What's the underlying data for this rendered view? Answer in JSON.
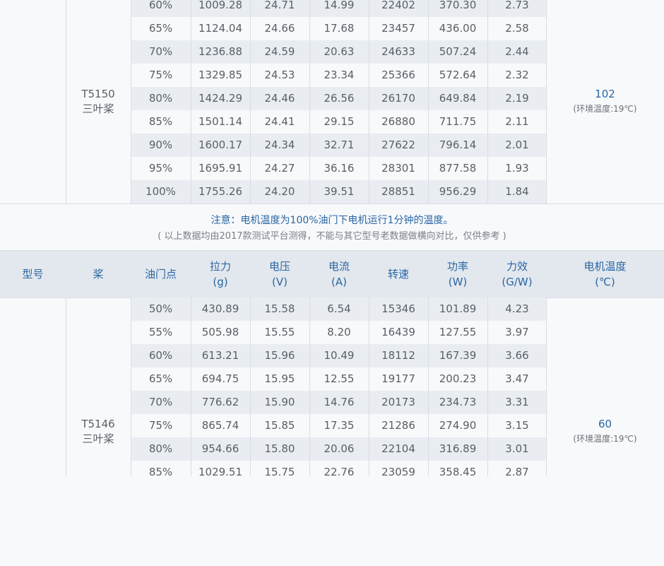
{
  "top_section": {
    "model": "T5150",
    "prop": "三叶桨",
    "temp": "102",
    "temp_note": "(环境温度:19℃)",
    "rows": [
      [
        "60%",
        "1009.28",
        "24.71",
        "14.99",
        "22402",
        "370.30",
        "2.73"
      ],
      [
        "65%",
        "1124.04",
        "24.66",
        "17.68",
        "23457",
        "436.00",
        "2.58"
      ],
      [
        "70%",
        "1236.88",
        "24.59",
        "20.63",
        "24633",
        "507.24",
        "2.44"
      ],
      [
        "75%",
        "1329.85",
        "24.53",
        "23.34",
        "25366",
        "572.64",
        "2.32"
      ],
      [
        "80%",
        "1424.29",
        "24.46",
        "26.56",
        "26170",
        "649.84",
        "2.19"
      ],
      [
        "85%",
        "1501.14",
        "24.41",
        "29.15",
        "26880",
        "711.75",
        "2.11"
      ],
      [
        "90%",
        "1600.17",
        "24.34",
        "32.71",
        "27622",
        "796.14",
        "2.01"
      ],
      [
        "95%",
        "1695.91",
        "24.27",
        "36.16",
        "28301",
        "877.58",
        "1.93"
      ],
      [
        "100%",
        "1755.26",
        "24.20",
        "39.51",
        "28851",
        "956.29",
        "1.84"
      ]
    ]
  },
  "note": {
    "main": "注意：电机温度为100%油门下电机运行1分钟的温度。",
    "sub": "( 以上数据均由2017款测试平台测得，不能与其它型号老数据做横向对比，仅供参考 )"
  },
  "headers": [
    {
      "line1": "型号",
      "line2": ""
    },
    {
      "line1": "桨",
      "line2": ""
    },
    {
      "line1": "油门点",
      "line2": ""
    },
    {
      "line1": "拉力",
      "line2": "(g)"
    },
    {
      "line1": "电压",
      "line2": "(V)"
    },
    {
      "line1": "电流",
      "line2": "(A)"
    },
    {
      "line1": "转速",
      "line2": ""
    },
    {
      "line1": "功率",
      "line2": "(W)"
    },
    {
      "line1": "力效",
      "line2": "(G/W)"
    },
    {
      "line1": "电机温度",
      "line2": "(℃)"
    }
  ],
  "bottom_section": {
    "model": "T5146",
    "prop": "三叶桨",
    "temp": "60",
    "temp_note": "(环境温度:19℃)",
    "rows": [
      [
        "50%",
        "430.89",
        "15.58",
        "6.54",
        "15346",
        "101.89",
        "4.23"
      ],
      [
        "55%",
        "505.98",
        "15.55",
        "8.20",
        "16439",
        "127.55",
        "3.97"
      ],
      [
        "60%",
        "613.21",
        "15.96",
        "10.49",
        "18112",
        "167.39",
        "3.66"
      ],
      [
        "65%",
        "694.75",
        "15.95",
        "12.55",
        "19177",
        "200.23",
        "3.47"
      ],
      [
        "70%",
        "776.62",
        "15.90",
        "14.76",
        "20173",
        "234.73",
        "3.31"
      ],
      [
        "75%",
        "865.74",
        "15.85",
        "17.35",
        "21286",
        "274.90",
        "3.15"
      ],
      [
        "80%",
        "954.66",
        "15.80",
        "20.06",
        "22104",
        "316.89",
        "3.01"
      ],
      [
        "85%",
        "1029.51",
        "15.75",
        "22.76",
        "23059",
        "358.45",
        "2.87"
      ]
    ]
  }
}
